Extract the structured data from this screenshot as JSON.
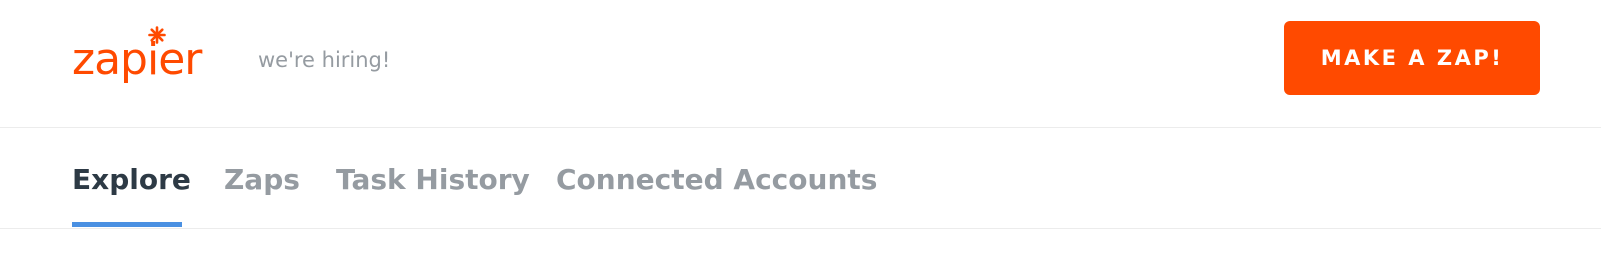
{
  "header": {
    "logo_text": "zapier",
    "hiring_link": "we're hiring!",
    "cta_label": "MAKE A ZAP!"
  },
  "nav": {
    "tabs": [
      {
        "label": "Explore",
        "active": true
      },
      {
        "label": "Zaps",
        "active": false
      },
      {
        "label": "Task History",
        "active": false
      },
      {
        "label": "Connected Accounts",
        "active": false
      }
    ]
  },
  "colors": {
    "brand": "#ff4a00",
    "active_tab_text": "#2d3a45",
    "inactive_tab_text": "#959ba1",
    "active_underline": "#4a90e2",
    "divider": "#ececec"
  },
  "icons": {
    "logo_mark": "asterisk-icon"
  }
}
